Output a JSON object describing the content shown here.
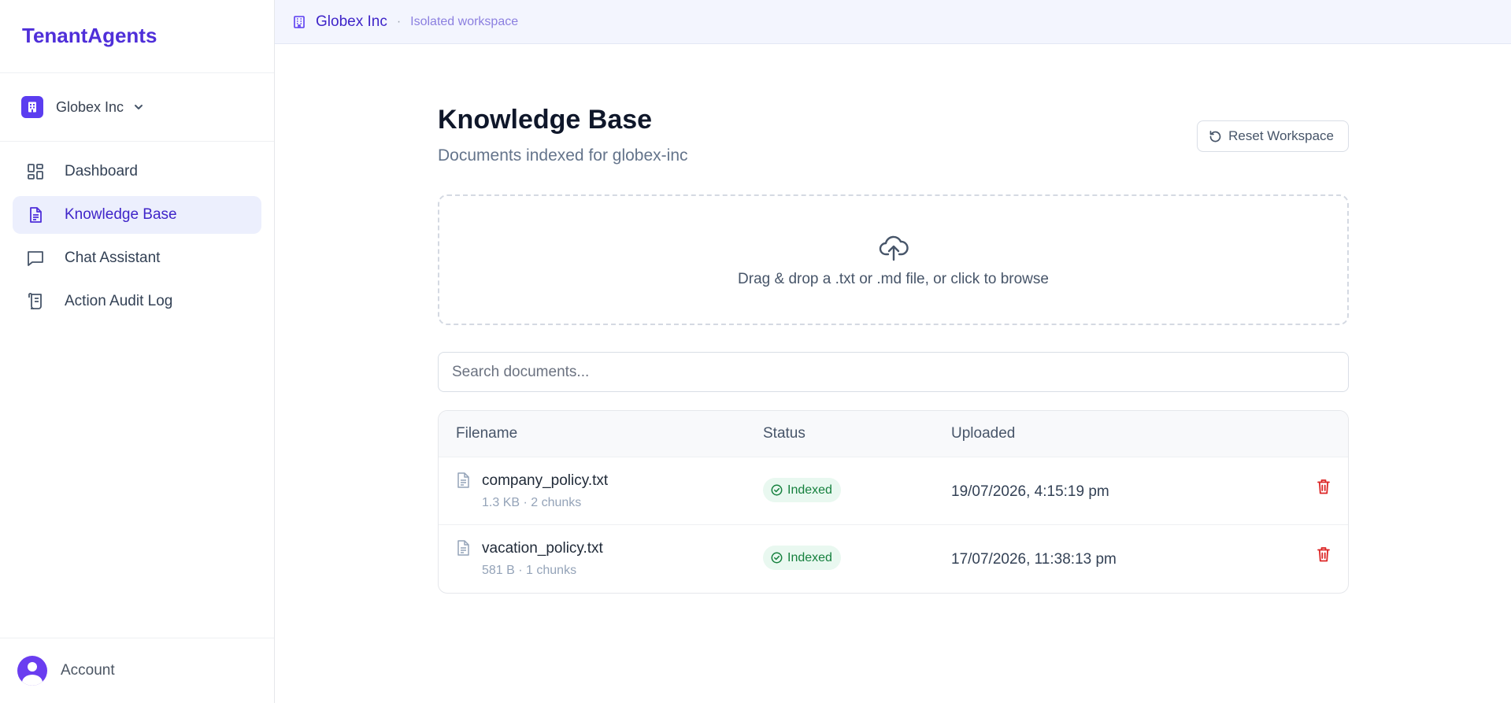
{
  "brand": "TenantAgents",
  "tenant_selector": {
    "name": "Globex Inc",
    "icon": "building-icon"
  },
  "nav": [
    {
      "label": "Dashboard",
      "icon": "dashboard-icon",
      "active": false
    },
    {
      "label": "Knowledge Base",
      "icon": "document-icon",
      "active": true
    },
    {
      "label": "Chat Assistant",
      "icon": "chat-icon",
      "active": false
    },
    {
      "label": "Action Audit Log",
      "icon": "scroll-icon",
      "active": false
    }
  ],
  "account": {
    "label": "Account"
  },
  "topbar": {
    "tenant_name": "Globex Inc",
    "separator": "·",
    "subtitle": "Isolated workspace"
  },
  "page": {
    "title": "Knowledge Base",
    "subtitle": "Documents indexed for globex-inc",
    "reset_label": "Reset Workspace"
  },
  "dropzone": {
    "text": "Drag & drop a .txt or .md file, or click to browse"
  },
  "search": {
    "placeholder": "Search documents..."
  },
  "table": {
    "headers": {
      "filename": "Filename",
      "status": "Status",
      "uploaded": "Uploaded"
    },
    "rows": [
      {
        "filename": "company_policy.txt",
        "meta": "1.3 KB · 2 chunks",
        "status": "Indexed",
        "uploaded": "19/07/2026, 4:15:19 pm"
      },
      {
        "filename": "vacation_policy.txt",
        "meta": "581 B · 1 chunks",
        "status": "Indexed",
        "uploaded": "17/07/2026, 11:38:13 pm"
      }
    ]
  },
  "colors": {
    "accent": "#4f2fd9",
    "active_nav_bg": "#eceffd",
    "status_indexed": "#15803d",
    "delete": "#dc2626"
  }
}
